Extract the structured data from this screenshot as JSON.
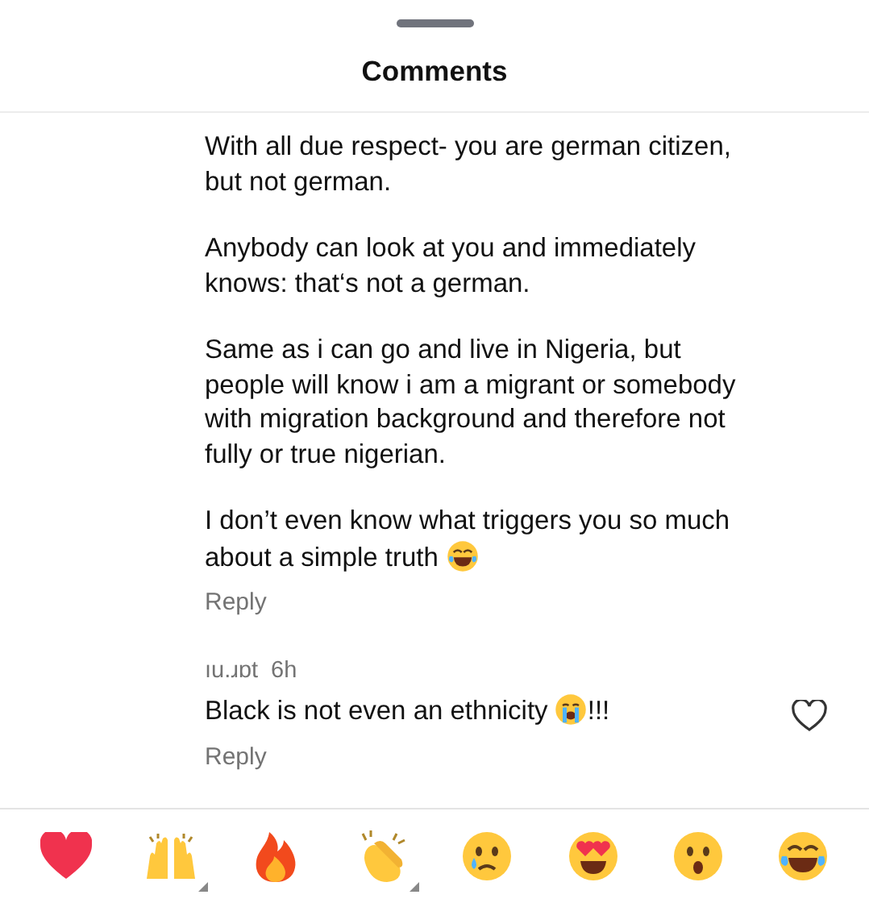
{
  "sheet": {
    "title": "Comments"
  },
  "comments": [
    {
      "paragraphs": [
        "With all due respect- you are german citizen, but not german.",
        "Anybody can look at you and immediately knows: that‘s not a german.",
        "Same as i can go and live in Nigeria, but people will know i am a migrant or somebody with migration background and therefore not fully or true nigerian.",
        "I don’t even know what triggers you so much about a simple truth"
      ],
      "trailing_icon": {
        "kind": "laughing"
      },
      "reply": "Reply"
    },
    {
      "username": "ıu.ɹɒt",
      "time": "6h",
      "paragraphs": [
        "Black is not even an ethnicity"
      ],
      "trailing_icon": {
        "kind": "crying"
      },
      "after_icon": "!!!",
      "reply": "Reply",
      "liked": false
    }
  ],
  "reactions": [
    {
      "kind": "heart",
      "variants": false
    },
    {
      "kind": "raised-hands",
      "variants": true
    },
    {
      "kind": "fire",
      "variants": false
    },
    {
      "kind": "clapping",
      "variants": true
    },
    {
      "kind": "sad-tear",
      "variants": false
    },
    {
      "kind": "heart-eyes",
      "variants": false
    },
    {
      "kind": "surprised",
      "variants": false
    },
    {
      "kind": "laughing",
      "variants": false
    }
  ]
}
